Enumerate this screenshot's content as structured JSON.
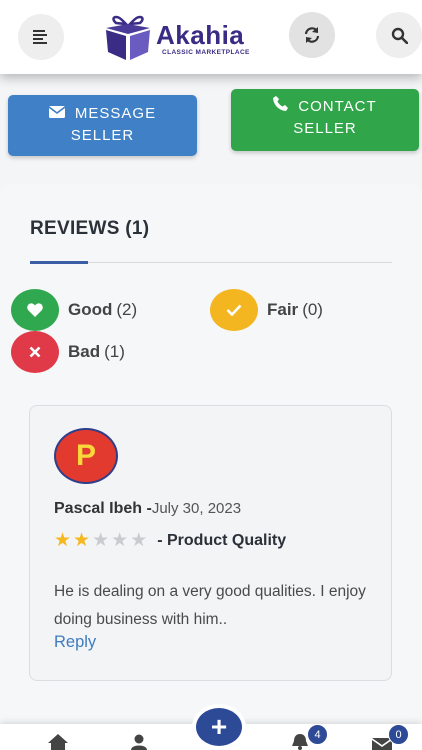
{
  "header": {
    "brand_name": "Akahia",
    "brand_tagline": "CLASSIC MARKETPLACE",
    "menu_icon": "menu-icon",
    "refresh_icon": "refresh-icon",
    "search_icon": "search-icon"
  },
  "actions": {
    "message_line1": "MESSAGE",
    "message_line2": "SELLER",
    "contact_line1": "CONTACT",
    "contact_line2": "SELLER",
    "message_color": "#3f80c6",
    "contact_color": "#30a54a"
  },
  "reviews": {
    "title": "REVIEWS (1)",
    "summary": [
      {
        "label": "Good",
        "count": "(2)",
        "color": "#2fa84f",
        "icon": "heart-icon"
      },
      {
        "label": "Fair",
        "count": "(0)",
        "color": "#f3b621",
        "icon": "check-icon"
      },
      {
        "label": "Bad",
        "count": "(1)",
        "color": "#e03a48",
        "icon": "x-icon"
      }
    ],
    "items": [
      {
        "avatar_letter": "P",
        "name": "Pascal Ibeh -",
        "date": "July 30, 2023",
        "stars": 2,
        "max_stars": 5,
        "aspect": "- Product Quality",
        "text": "He is dealing on a very good qualities. I enjoy doing business with him..",
        "reply_label": "Reply"
      }
    ]
  },
  "bottom_nav": {
    "items": [
      "home-icon",
      "user-icon",
      "add-icon",
      "bell-icon",
      "mail-icon"
    ],
    "fab_label": "+",
    "notifications_count": "4",
    "messages_count": "0"
  }
}
